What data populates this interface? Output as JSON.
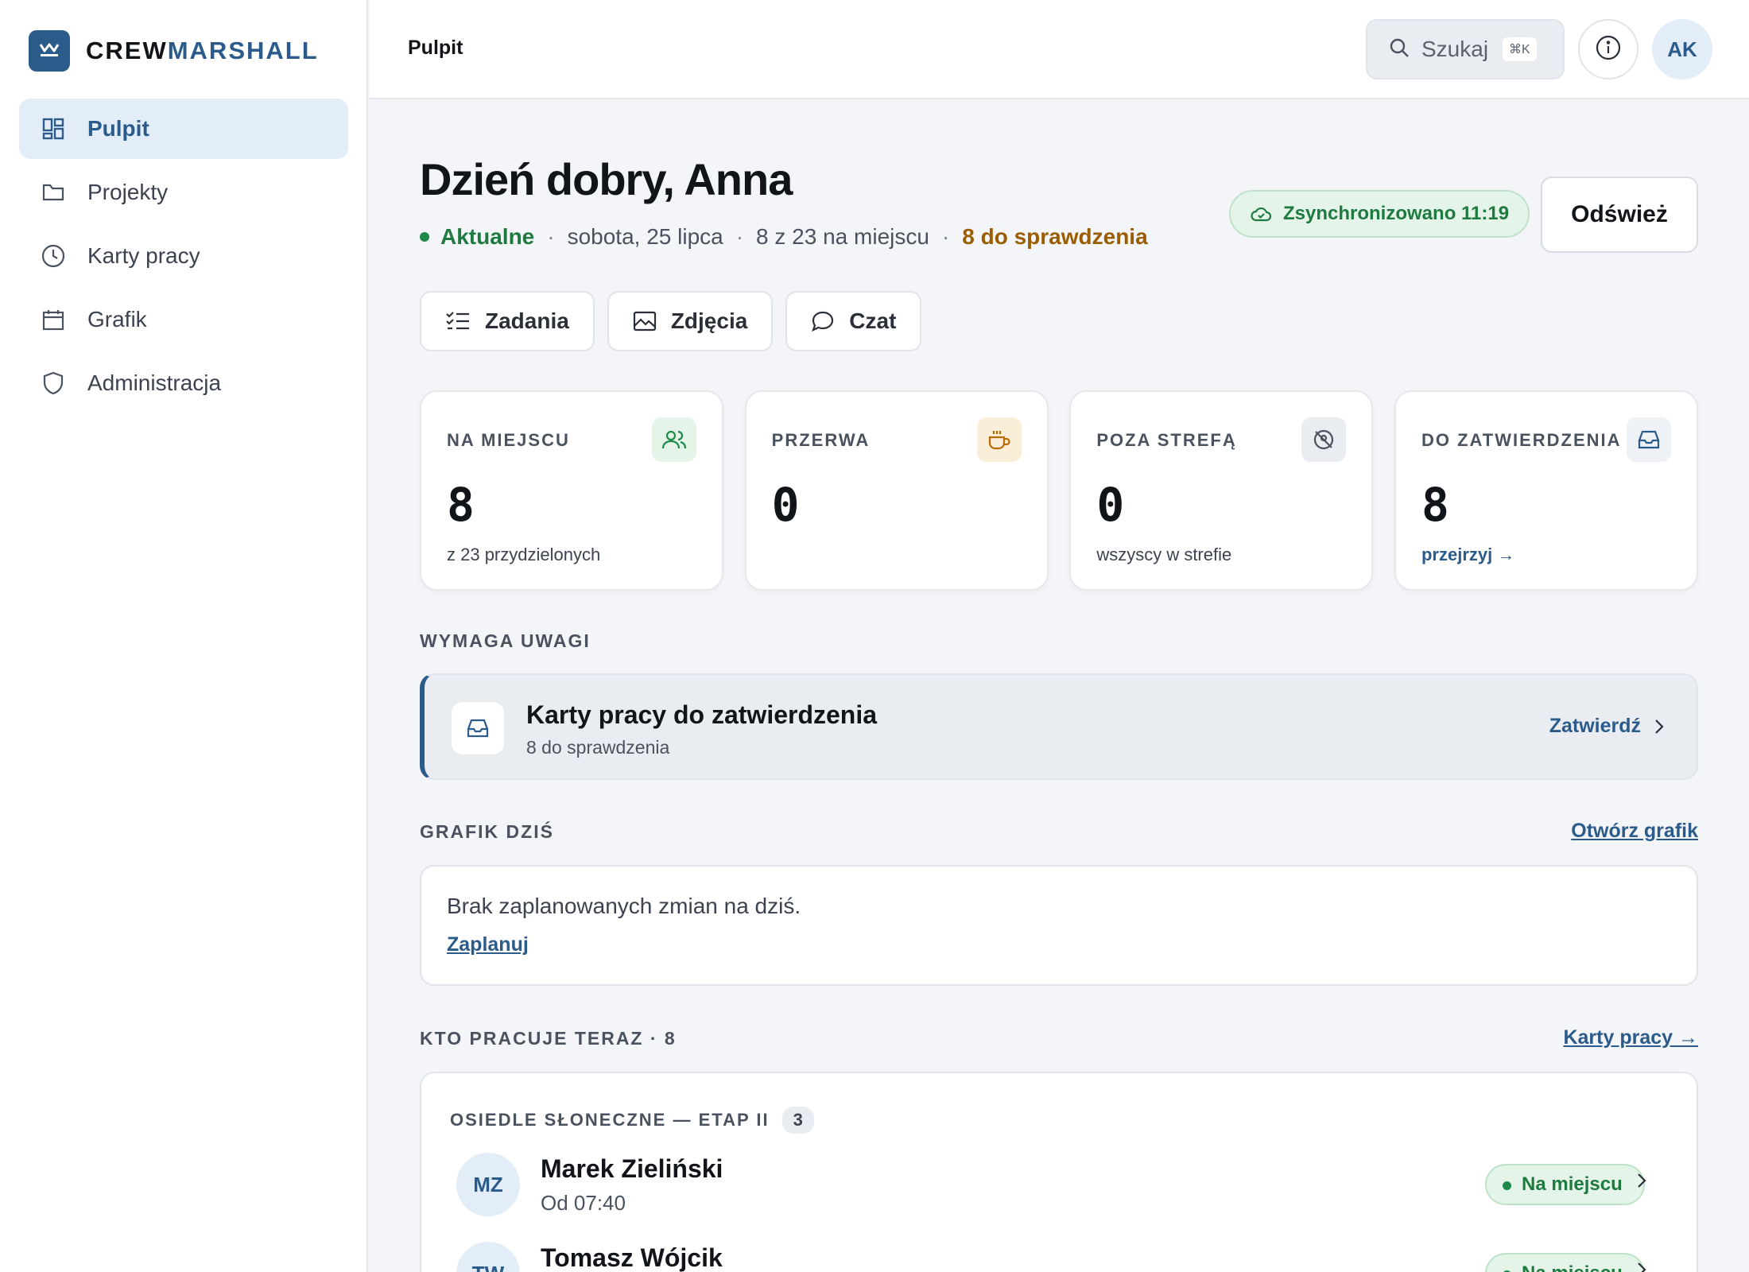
{
  "brand": {
    "part1": "CREW",
    "part2": "MARSHALL",
    "accent": "#2b5b8a"
  },
  "sidebar": {
    "items": [
      {
        "label": "Pulpit",
        "icon": "dashboard-icon",
        "active": true
      },
      {
        "label": "Projekty",
        "icon": "folder-icon",
        "active": false
      },
      {
        "label": "Karty pracy",
        "icon": "clock-icon",
        "active": false
      },
      {
        "label": "Grafik",
        "icon": "calendar-icon",
        "active": false
      },
      {
        "label": "Administracja",
        "icon": "shield-icon",
        "active": false
      }
    ]
  },
  "topbar": {
    "breadcrumb": "Pulpit",
    "search_label": "Szukaj",
    "search_shortcut": "⌘K",
    "avatar_initials": "AK"
  },
  "header": {
    "greeting": "Dzień dobry, Anna",
    "status": "Aktualne",
    "date": "sobota, 25 lipca",
    "onsite_summary": "8 z 23 na miejscu",
    "review_summary": "8 do sprawdzenia",
    "sync_label": "Zsynchronizowano 11:19",
    "refresh_label": "Odśwież"
  },
  "tabs": [
    {
      "label": "Zadania",
      "icon": "checklist-icon"
    },
    {
      "label": "Zdjęcia",
      "icon": "image-icon"
    },
    {
      "label": "Czat",
      "icon": "chat-icon"
    }
  ],
  "stats": {
    "onsite": {
      "title": "NA MIEJSCU",
      "value": "8",
      "sub": "z 23 przydzielonych",
      "icon": "users-icon"
    },
    "break": {
      "title": "PRZERWA",
      "value": "0",
      "icon": "coffee-icon"
    },
    "outside": {
      "title": "POZA STREFĄ",
      "value": "0",
      "sub": "wszyscy w strefie",
      "icon": "location-off-icon"
    },
    "approve": {
      "title": "DO ZATWIERDZENIA",
      "value": "8",
      "link": "przejrzyj →",
      "icon": "inbox-icon"
    }
  },
  "attention": {
    "heading": "WYMAGA UWAGI",
    "title": "Karty pracy do zatwierdzenia",
    "sub": "8 do sprawdzenia",
    "action": "Zatwierdź"
  },
  "schedule": {
    "heading": "GRAFIK DZIŚ",
    "link": "Otwórz grafik",
    "empty_text": "Brak zaplanowanych zmian na dziś.",
    "plan_link": "Zaplanuj"
  },
  "crew": {
    "heading": "KTO PRACUJE TERAZ · 8",
    "link": "Karty pracy →",
    "group_name": "OSIEDLE SŁONECZNE — ETAP II",
    "group_count": "3",
    "people": [
      {
        "initials": "MZ",
        "name": "Marek Zieliński",
        "time": "Od 07:40",
        "status": "Na miejscu"
      },
      {
        "initials": "TW",
        "name": "Tomasz Wójcik",
        "time": "",
        "status": "Na miejscu"
      }
    ]
  }
}
